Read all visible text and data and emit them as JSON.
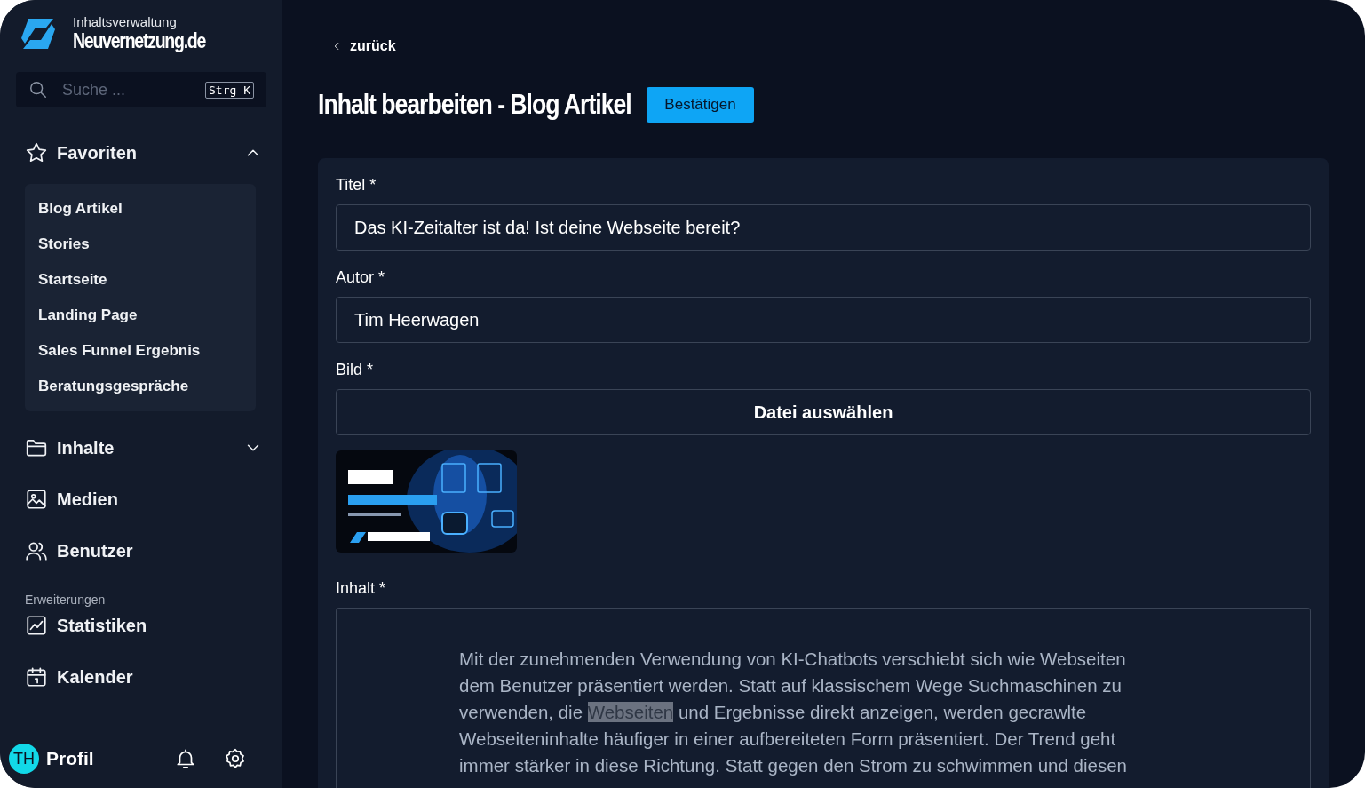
{
  "brand": {
    "subtitle": "Inhaltsverwaltung",
    "name": "Neuvernetzung.de"
  },
  "search": {
    "placeholder": "Suche ...",
    "shortcut": "Strg K"
  },
  "nav": [
    {
      "kind": "group",
      "label": "Favoriten",
      "expanded": true,
      "children": [
        {
          "label": "Blog Artikel"
        },
        {
          "label": "Stories"
        },
        {
          "label": "Startseite"
        },
        {
          "label": "Landing Page"
        },
        {
          "label": "Sales Funnel Ergebnis"
        },
        {
          "label": "Beratungsgespräche"
        }
      ]
    },
    {
      "kind": "group",
      "label": "Inhalte",
      "expanded": false
    },
    {
      "kind": "link",
      "label": "Medien"
    },
    {
      "kind": "link",
      "label": "Benutzer"
    },
    {
      "kind": "section",
      "label": "Erweiterungen"
    },
    {
      "kind": "link",
      "label": "Statistiken"
    },
    {
      "kind": "link",
      "label": "Kalender"
    }
  ],
  "profile": {
    "initials": "TH",
    "label": "Profil"
  },
  "back": "zurück",
  "page_title": "Inhalt bearbeiten - Blog Artikel",
  "confirm_button": "Bestätigen",
  "fields": [
    {
      "kind": "text",
      "label": "Titel *",
      "value": "Das KI-Zeitalter ist da! Ist deine Webseite bereit?"
    },
    {
      "kind": "text",
      "label": "Autor *",
      "value": "Tim Heerwagen"
    },
    {
      "kind": "file",
      "label": "Bild *",
      "button": "Datei auswählen"
    },
    {
      "kind": "richtext",
      "label": "Inhalt *",
      "text_before": "Mit der zunehmenden Verwendung von KI-Chatbots verschiebt sich wie Webseiten dem Benutzer präsentiert werden. Statt auf klassischem Wege Suchmaschinen zu verwenden, die ",
      "selected_text": "Webseiten",
      "text_after": " und Ergebnisse direkt anzeigen, werden gecrawlte Webseiteninhalte häufiger in einer aufbereiteten Form präsentiert. Der Trend geht immer stärker in diese Richtung. Statt gegen den Strom zu schwimmen und diesen"
    }
  ]
}
